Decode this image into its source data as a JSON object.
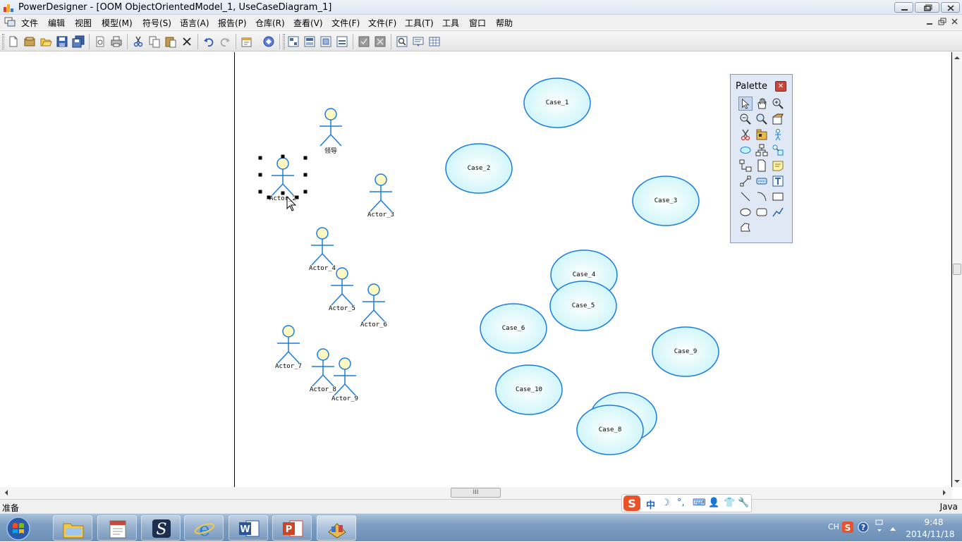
{
  "window": {
    "title": "PowerDesigner - [OOM ObjectOrientedModel_1, UseCaseDiagram_1]"
  },
  "menu": {
    "items": [
      "文件",
      "编辑",
      "视图",
      "模型(M)",
      "符号(S)",
      "语言(A)",
      "报告(P)",
      "仓库(R)",
      "查看(V)",
      "文件(F)",
      "文件(F)",
      "工具(T)",
      "工具",
      "窗口",
      "帮助"
    ]
  },
  "toolbar": {
    "buttons": [
      "new-icon",
      "new-project-icon",
      "open-icon",
      "save-icon",
      "save-all-icon",
      "print-preview-icon",
      "print-icon",
      "cut-icon",
      "copy-icon",
      "paste-icon",
      "delete-icon",
      "undo-icon",
      "redo-icon",
      "properties-icon",
      "model-icon",
      "layout-1-icon",
      "layout-2-icon",
      "layout-3-icon",
      "layout-4-icon",
      "check-icon",
      "generate-icon",
      "zoom-fit-icon",
      "list-icon",
      "grid-icon"
    ]
  },
  "diagram": {
    "actors": [
      {
        "label": "领导"
      },
      {
        "label": "Actor_2",
        "selected": true
      },
      {
        "label": "Actor_3"
      },
      {
        "label": "Actor_4"
      },
      {
        "label": "Actor_5"
      },
      {
        "label": "Actor_6"
      },
      {
        "label": "Actor_7"
      },
      {
        "label": "Actor_8"
      },
      {
        "label": "Actor_9"
      }
    ],
    "use_cases": [
      {
        "label": "Case_1"
      },
      {
        "label": "Case_2"
      },
      {
        "label": "Case_3"
      },
      {
        "label": "Case_4"
      },
      {
        "label": "Case_5"
      },
      {
        "label": "Case_6"
      },
      {
        "label": "Case_9"
      },
      {
        "label": "Case_10"
      },
      {
        "label": ""
      },
      {
        "label": "Case_8"
      }
    ],
    "colors": {
      "actor_stroke": "#1a7de0",
      "actor_head_fill": "#fff8c0",
      "case_stroke": "#1a7de0",
      "case_fill_light": "#ffffff",
      "case_fill_dark": "#c8f4f8"
    }
  },
  "palette": {
    "title": "Palette",
    "close_icon": "close-icon",
    "tools": [
      "pointer-icon",
      "hand-icon",
      "zoom-in-icon",
      "zoom-out-icon",
      "zoom-area-icon",
      "open-package-icon",
      "delete-icon",
      "package-icon",
      "actor-icon",
      "use-case-icon",
      "class-icon",
      "interface-icon",
      "generalization-icon",
      "file-icon",
      "note-icon",
      "association-icon",
      "dependency-icon",
      "text-icon",
      "line-icon",
      "arc-icon",
      "rectangle-icon",
      "ellipse-icon",
      "rounded-rect-icon",
      "polyline-icon",
      "polygon-icon"
    ]
  },
  "scrollbar": {
    "h_thumb_label": "III"
  },
  "status": {
    "left": "准备",
    "right": "Java"
  },
  "ime": {
    "items": [
      "中",
      "☽",
      "°,",
      "⌨",
      "👤",
      "👕",
      "🔧"
    ]
  },
  "taskbar": {
    "apps": [
      "explorer",
      "notepad-app",
      "writer-app",
      "ie",
      "word",
      "powerpoint",
      "powerdesigner"
    ]
  },
  "tray": {
    "lang": "CH",
    "time": "9:48",
    "date": "2014/11/18"
  }
}
